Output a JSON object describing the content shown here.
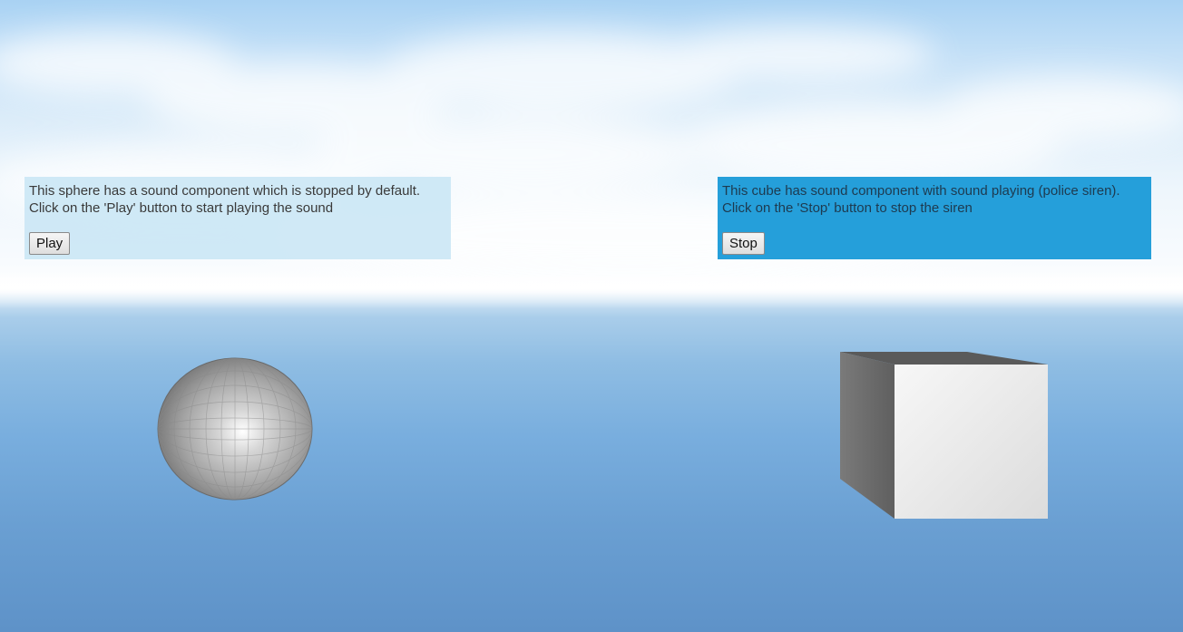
{
  "sphere_panel": {
    "line1": "This sphere has a sound component which is stopped by default.",
    "line2": "Click on the 'Play' button to start playing the sound",
    "button_label": "Play",
    "background": "#c8e5f5"
  },
  "cube_panel": {
    "line1": "This cube has sound component with sound playing (police siren).",
    "line2": "Click on the 'Stop' button to stop the siren",
    "button_label": "Stop",
    "background": "#259fda"
  },
  "scene": {
    "sky_color": "#a9d2f3",
    "ground_color": "#6a9fd2",
    "objects": [
      "sphere",
      "cube"
    ]
  }
}
